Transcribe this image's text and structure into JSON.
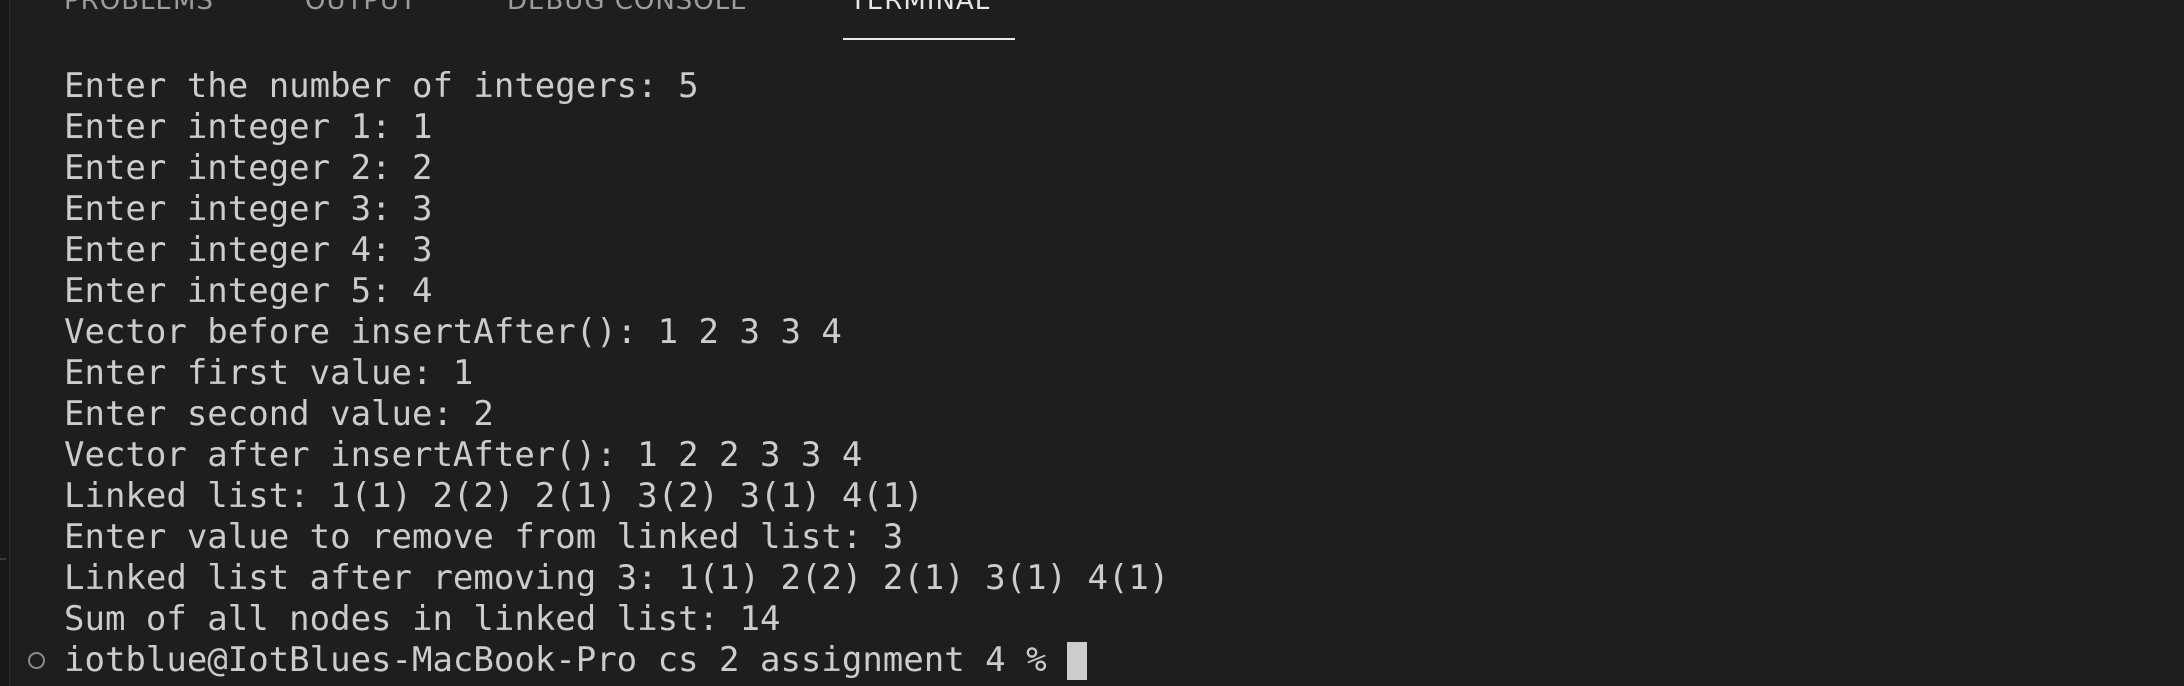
{
  "panel": {
    "tabs": [
      {
        "label": "PROBLEMS",
        "active": false
      },
      {
        "label": "OUTPUT",
        "active": false
      },
      {
        "label": "DEBUG CONSOLE",
        "active": false
      },
      {
        "label": "TERMINAL",
        "active": true
      }
    ]
  },
  "terminal": {
    "lines": [
      "Enter the number of integers: 5",
      "Enter integer 1: 1",
      "Enter integer 2: 2",
      "Enter integer 3: 3",
      "Enter integer 4: 3",
      "Enter integer 5: 4",
      "Vector before insertAfter(): 1 2 3 3 4",
      "Enter first value: 1",
      "Enter second value: 2",
      "Vector after insertAfter(): 1 2 2 3 3 4",
      "Linked list: 1(1) 2(2) 2(1) 3(2) 3(1) 4(1)",
      "Enter value to remove from linked list: 3",
      "Linked list after removing 3: 1(1) 2(2) 2(1) 3(1) 4(1)",
      "Sum of all nodes in linked list: 14"
    ],
    "prompt": "iotblue@IotBlues-MacBook-Pro cs 2 assignment 4 %"
  },
  "colors": {
    "background": "#1e1e1e",
    "text": "#cccccc",
    "tab_inactive": "#9d9d9d",
    "tab_active": "#e7e7e7"
  },
  "icons": {
    "prompt_status": "circle-outline-icon",
    "cursor": "block-cursor-icon"
  }
}
